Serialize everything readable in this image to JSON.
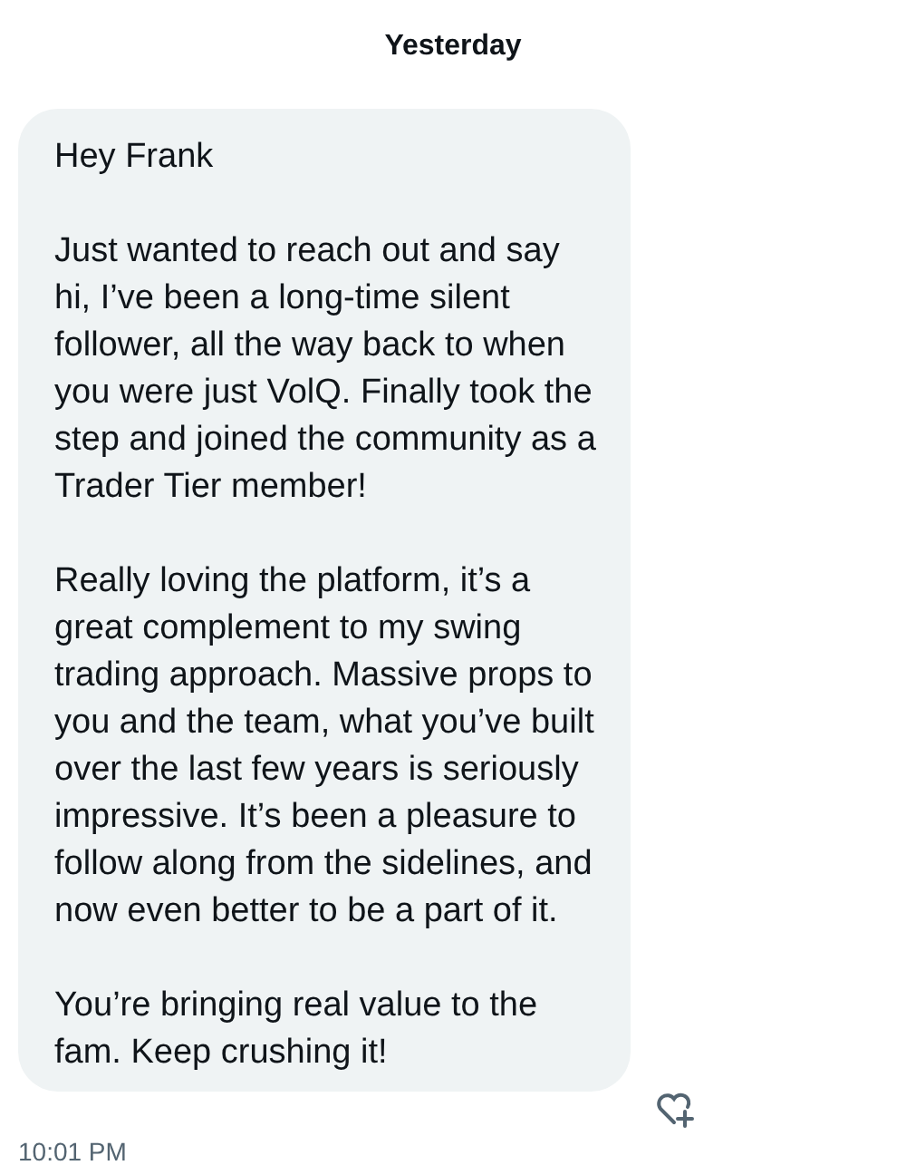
{
  "date_divider": "Yesterday",
  "message": {
    "paragraphs": [
      "Hey Frank",
      "Just wanted to reach out and say hi, I’ve been a long-time silent follower, all the way back to when you were just VolQ. Finally took the step and joined the community as a Trader Tier member!",
      "Really loving the platform, it’s a great complement to my swing trading approach. Massive props to you and the team, what you’ve built over the last few years is seriously impressive. It’s been a pleasure to follow along from the sidelines, and now even better to be a part of it.",
      "You’re bringing real value to the fam. Keep crushing it!"
    ],
    "time": "10:01 PM"
  }
}
